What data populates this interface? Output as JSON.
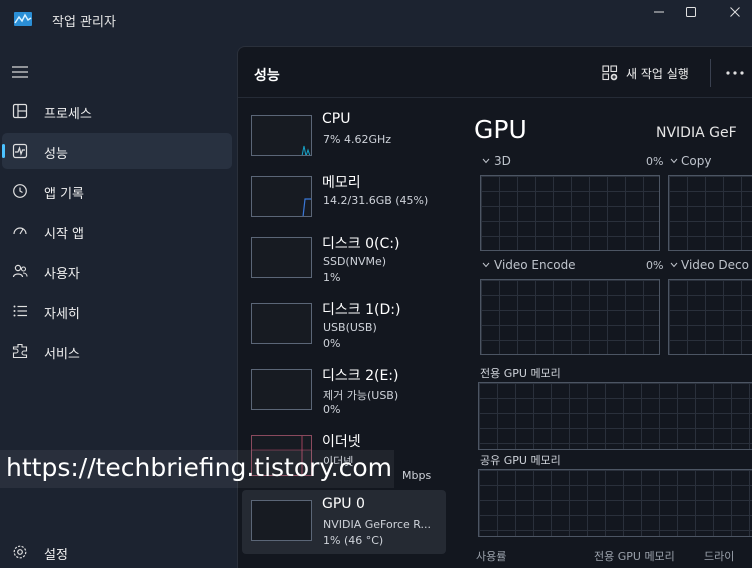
{
  "window": {
    "title": "작업 관리자"
  },
  "nav": {
    "items": [
      {
        "label": "프로세스",
        "icon": "processes-icon"
      },
      {
        "label": "성능",
        "icon": "performance-icon",
        "active": true
      },
      {
        "label": "앱 기록",
        "icon": "app-history-icon"
      },
      {
        "label": "시작 앱",
        "icon": "startup-apps-icon"
      },
      {
        "label": "사용자",
        "icon": "users-icon"
      },
      {
        "label": "자세히",
        "icon": "details-icon"
      },
      {
        "label": "서비스",
        "icon": "services-icon"
      }
    ],
    "settings_label": "설정"
  },
  "header": {
    "title": "성능",
    "new_task_label": "새 작업 실행"
  },
  "devices": [
    {
      "name": "CPU",
      "sub1": "7% 4.62GHz",
      "sub2": ""
    },
    {
      "name": "메모리",
      "sub1": "14.2/31.6GB (45%)",
      "sub2": ""
    },
    {
      "name": "디스크 0(C:)",
      "sub1": "SSD(NVMe)",
      "sub2": "1%"
    },
    {
      "name": "디스크 1(D:)",
      "sub1": "USB(USB)",
      "sub2": "0%"
    },
    {
      "name": "디스크 2(E:)",
      "sub1": "제거 가능(USB)",
      "sub2": "0%"
    },
    {
      "name": "이더넷",
      "sub1": "이더넷",
      "sub2": "Mbps"
    },
    {
      "name": "GPU 0",
      "sub1": "NVIDIA GeForce R...",
      "sub2": "1% (46 °C)",
      "active": true
    }
  ],
  "detail": {
    "title": "GPU",
    "model": "NVIDIA GeF",
    "engines": [
      {
        "label": "3D",
        "pct": "0%"
      },
      {
        "label": "Copy",
        "pct": ""
      },
      {
        "label": "Video Encode",
        "pct": "0%"
      },
      {
        "label": "Video Deco",
        "pct": ""
      }
    ],
    "dedicated_memory_label": "전용 GPU 메모리",
    "shared_memory_label": "공유 GPU 메모리",
    "bottom_labels": [
      "사용률",
      "전용 GPU 메모리",
      "드라이"
    ]
  },
  "watermark": {
    "text": "https://techbriefing.tistory.com"
  },
  "colors": {
    "accent": "#4cc2ff",
    "cpu_graph": "#17a2c7",
    "memory_graph": "#3a78d8",
    "ethernet_graph": "#c04a6a"
  }
}
